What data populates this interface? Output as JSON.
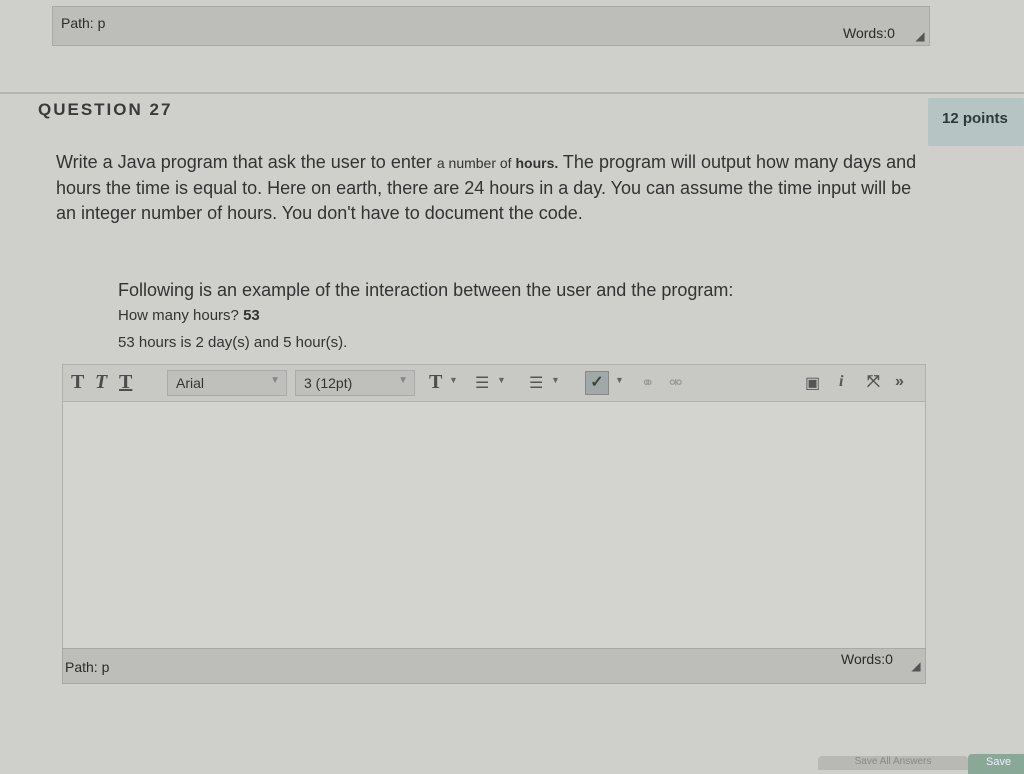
{
  "prev_editor": {
    "path": "Path: p",
    "words": "Words:0"
  },
  "question": {
    "title": "QUESTION 27",
    "points": "12 points",
    "text_part1": "Write a Java program that ask the user to enter ",
    "text_small": "a number of ",
    "text_bold": "hours.",
    "text_part2": " The program will output how many days and hours the time is equal to. Here on earth, there are 24 hours in a day.  You can assume the time input will be an integer number of hours.  You don't have to document the code.",
    "example_intro": "Following is an example of the interaction between the user and the program:",
    "example_prompt": "How many hours? ",
    "example_input": "53",
    "example_output": "53 hours is 2 day(s) and 5 hour(s)."
  },
  "toolbar": {
    "bold": "T",
    "italic": "T",
    "underline": "T",
    "font_family": "Arial",
    "font_size": "3 (12pt)",
    "text_color": "T",
    "icons": [
      "text-color-icon",
      "unordered-list-icon",
      "ordered-list-icon",
      "spellcheck-icon",
      "link-icon",
      "unlink-icon",
      "preview-icon",
      "info-icon",
      "fullscreen-icon",
      "expand-toolbar-icon"
    ]
  },
  "editor": {
    "path": "Path: p",
    "words": "Words:0"
  },
  "bottom": {
    "save_all": "Save All Answers",
    "save": "Save"
  }
}
